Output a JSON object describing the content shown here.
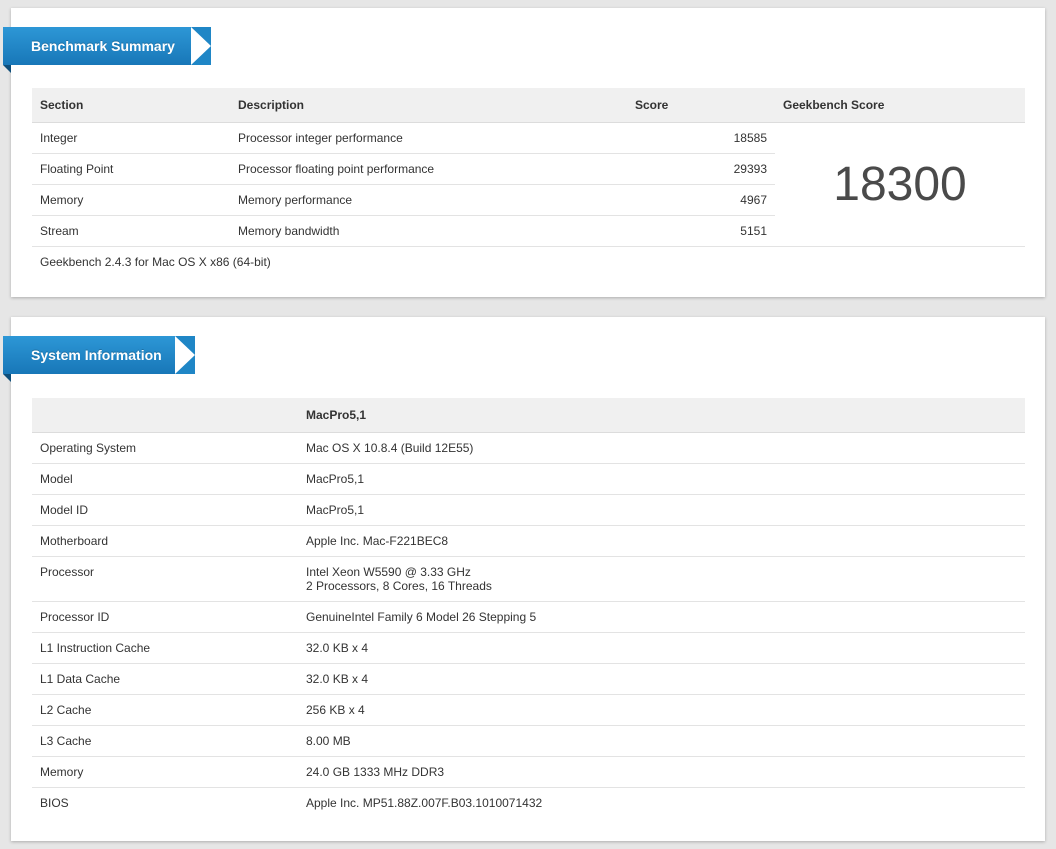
{
  "benchmark": {
    "title": "Benchmark Summary",
    "columns": {
      "section": "Section",
      "description": "Description",
      "score": "Score",
      "geekbench_score": "Geekbench Score"
    },
    "rows": [
      {
        "section": "Integer",
        "description": "Processor integer performance",
        "score": "18585"
      },
      {
        "section": "Floating Point",
        "description": "Processor floating point performance",
        "score": "29393"
      },
      {
        "section": "Memory",
        "description": "Memory performance",
        "score": "4967"
      },
      {
        "section": "Stream",
        "description": "Memory bandwidth",
        "score": "5151"
      }
    ],
    "geekbench_score": "18300",
    "footer": "Geekbench 2.4.3 for Mac OS X x86 (64-bit)"
  },
  "system": {
    "title": "System Information",
    "header_value": "MacPro5,1",
    "rows": [
      {
        "label": "Operating System",
        "value": "Mac OS X 10.8.4 (Build 12E55)"
      },
      {
        "label": "Model",
        "value": "MacPro5,1"
      },
      {
        "label": "Model ID",
        "value": "MacPro5,1"
      },
      {
        "label": "Motherboard",
        "value": "Apple Inc. Mac-F221BEC8"
      },
      {
        "label": "Processor",
        "value": "Intel Xeon W5590 @ 3.33 GHz",
        "value2": "2 Processors, 8 Cores, 16 Threads"
      },
      {
        "label": "Processor ID",
        "value": "GenuineIntel Family 6 Model 26 Stepping 5"
      },
      {
        "label": "L1 Instruction Cache",
        "value": "32.0 KB x 4"
      },
      {
        "label": "L1 Data Cache",
        "value": "32.0 KB x 4"
      },
      {
        "label": "L2 Cache",
        "value": "256 KB x 4"
      },
      {
        "label": "L3 Cache",
        "value": "8.00 MB"
      },
      {
        "label": "Memory",
        "value": "24.0 GB 1333 MHz DDR3"
      },
      {
        "label": "BIOS",
        "value": "Apple Inc. MP51.88Z.007F.B03.1010071432"
      }
    ]
  },
  "colors": {
    "ribbon": "#1f86c6",
    "header_bg": "#f0f0f0",
    "page_bg": "#e6e6e6"
  }
}
